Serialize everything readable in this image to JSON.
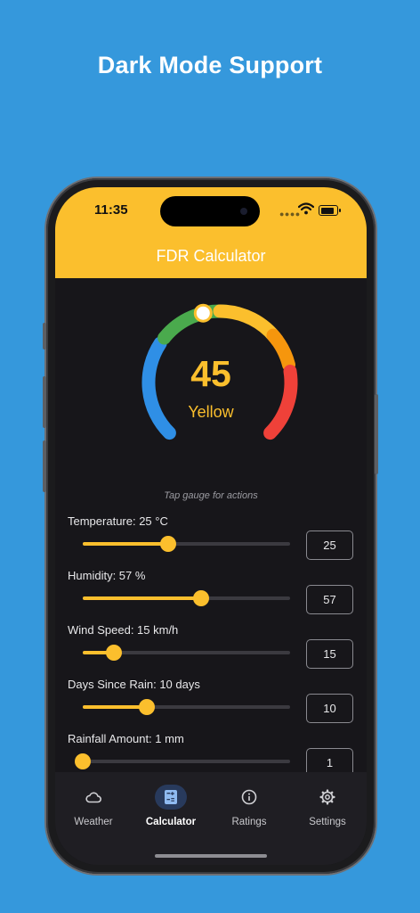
{
  "headline": "Dark Mode Support",
  "status": {
    "time": "11:35"
  },
  "header": {
    "title": "FDR Calculator"
  },
  "gauge": {
    "value": "45",
    "rating": "Yellow",
    "fraction": 0.45,
    "hint": "Tap gauge for actions"
  },
  "sliders": [
    {
      "label": "Temperature: 25 °C",
      "value": "25",
      "fraction": 0.41
    },
    {
      "label": "Humidity: 57 %",
      "value": "57",
      "fraction": 0.57
    },
    {
      "label": "Wind Speed: 15 km/h",
      "value": "15",
      "fraction": 0.15
    },
    {
      "label": "Days Since Rain: 10 days",
      "value": "10",
      "fraction": 0.31
    },
    {
      "label": "Rainfall Amount: 1 mm",
      "value": "1",
      "fraction": 0.0
    }
  ],
  "nav": [
    {
      "label": "Weather",
      "icon": "cloud-icon"
    },
    {
      "label": "Calculator",
      "icon": "calculator-icon",
      "active": true
    },
    {
      "label": "Ratings",
      "icon": "info-icon"
    },
    {
      "label": "Settings",
      "icon": "gear-icon"
    }
  ],
  "colors": {
    "accent": "#fbbf2d",
    "background": "#3598dc",
    "screen": "#17161a"
  }
}
